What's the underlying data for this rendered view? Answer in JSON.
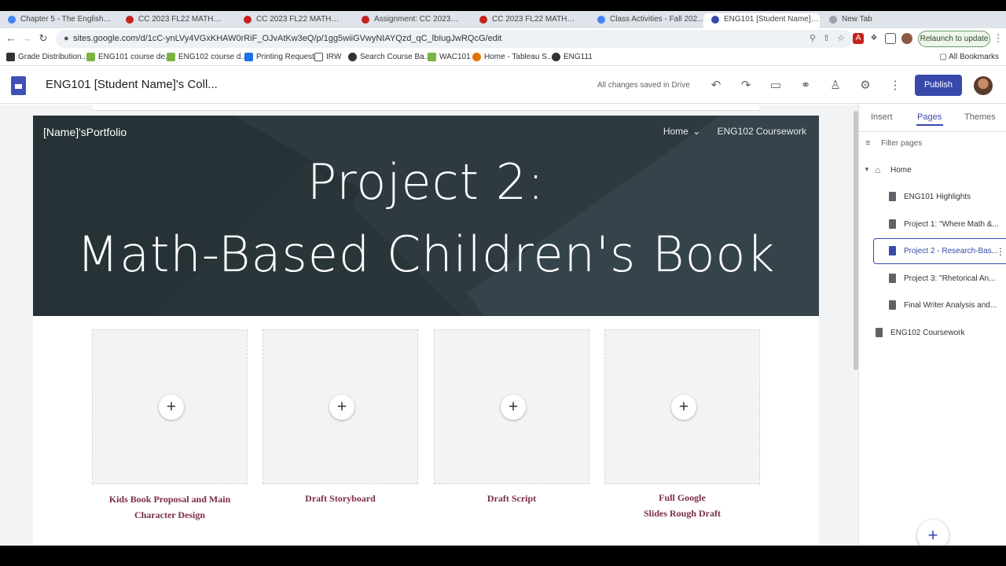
{
  "browser": {
    "tabs": [
      "Chapter 5 - The English…",
      "CC 2023 FL22 MATH…",
      "CC 2023 FL22 MATH…",
      "Assignment: CC 2023…",
      "CC 2023 FL22 MATH…",
      "Class Activities - Fall 202…",
      "ENG101 [Student Name]…",
      "New Tab"
    ],
    "url": "sites.google.com/d/1cC-ynLVy4VGxKHAW0rRiF_OJvAtKw3eQ/p/1gg5wiiGVwyNIAYQzd_qC_lbIugJwRQcG/edit",
    "relaunch_label": "Relaunch to update",
    "bookmarks": [
      "Grade Distribution...",
      "ENG101 course de...",
      "ENG102 course d...",
      "Printing Request",
      "IRW",
      "Search Course Ba...",
      "WAC101",
      "Home - Tableau S...",
      "ENG111"
    ],
    "all_bookmarks": "All Bookmarks"
  },
  "app": {
    "title": "ENG101 [Student Name]'s Coll...",
    "saved_status": "All changes saved in Drive",
    "publish_label": "Publish"
  },
  "site": {
    "name": "[Name]'sPortfolio",
    "nav": [
      "Home",
      "ENG102 Coursework"
    ],
    "hero_line1": "Project 2:",
    "hero_line2": "Math-Based Children's Book",
    "cards": [
      {
        "caption_line1": "Kids Book Proposal and Main",
        "caption_line2": "Character Design"
      },
      {
        "caption_line1": "Draft Storyboard",
        "caption_line2": ""
      },
      {
        "caption_line1": "Draft Script",
        "caption_line2": ""
      },
      {
        "caption_line1": "Full Google",
        "caption_line2": "Slides Rough Draft"
      }
    ]
  },
  "panel": {
    "tabs": [
      "Insert",
      "Pages",
      "Themes"
    ],
    "active_tab": "Pages",
    "filter_placeholder": "Filter pages",
    "pages": [
      "Home",
      "ENG101 Highlights",
      "Project 1: \"Where Math &...",
      "Project 2 - Research-Bas...",
      "Project 3: \"Rhetorical An...",
      "Final Writer Analysis and...",
      "ENG102 Coursework"
    ],
    "selected_page": "Project 2 - Research-Bas..."
  },
  "colors": {
    "accent": "#3949ab",
    "caption": "#7b2c4b",
    "hero": "#2e3a40"
  }
}
